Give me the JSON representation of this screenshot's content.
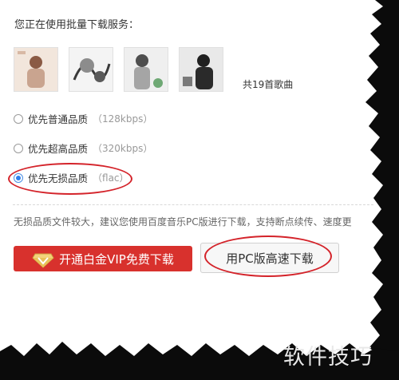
{
  "title": "您正在使用批量下载服务：",
  "albums": [
    {
      "name": "album-cover-1",
      "colors": [
        "#f2e6dc",
        "#c9a48f",
        "#8a5a44"
      ]
    },
    {
      "name": "album-cover-2",
      "colors": [
        "#f4f4f4",
        "#8c8c8c",
        "#3a3a3a"
      ]
    },
    {
      "name": "album-cover-3",
      "colors": [
        "#efefef",
        "#a5a5a5",
        "#4e4e4e"
      ]
    },
    {
      "name": "album-cover-4",
      "colors": [
        "#e9e9e9",
        "#7a7a7a",
        "#202020"
      ]
    }
  ],
  "song_count": "共19首歌曲",
  "options": [
    {
      "label": "优先普通品质",
      "rate": "（128kbps）",
      "checked": false
    },
    {
      "label": "优先超高品质",
      "rate": "（320kbps）",
      "checked": false
    },
    {
      "label": "优先无损品质",
      "rate": "（flac）",
      "checked": true
    }
  ],
  "hint": "无损品质文件较大，建议您使用百度音乐PC版进行下载，支持断点续传、速度更",
  "buttons": {
    "vip": "开通白金VIP免费下载",
    "pc": "用PC版高速下载"
  },
  "watermark": "软件技巧",
  "colors": {
    "accent_red": "#d8312d",
    "radio_blue": "#2f80ed",
    "annotation_red": "#d4232a"
  }
}
